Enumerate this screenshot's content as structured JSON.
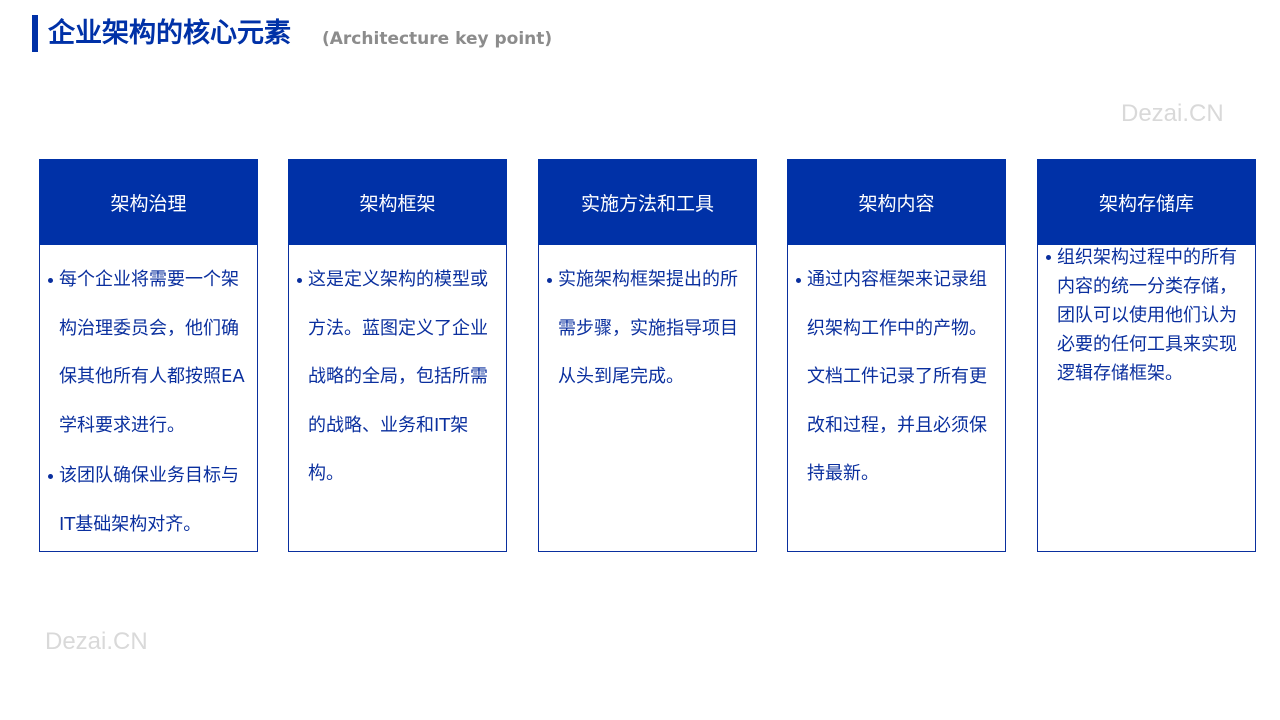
{
  "title": "企业架构的核心元素",
  "subtitle": "(Architecture key point)",
  "watermark": "Dezai.CN",
  "colors": {
    "accent": "#0031a7",
    "card_border": "#0a2f9e",
    "body_text": "#0a2f9e",
    "subtitle": "#8c8c8c",
    "watermark": "#d9d9d9"
  },
  "cards": [
    {
      "header": "架构治理",
      "bullets": [
        "每个企业将需要一个架构治理委员会，他们确保其他所有人都按照EA学科要求进行。",
        "该团队确保业务目标与IT基础架构对齐。"
      ]
    },
    {
      "header": "架构框架",
      "bullets": [
        "这是定义架构的模型或方法。蓝图定义了企业战略的全局，包括所需的战略、业务和IT架构。"
      ]
    },
    {
      "header": "实施方法和工具",
      "bullets": [
        "实施架构框架提出的所需步骤，实施指导项目从头到尾完成。"
      ]
    },
    {
      "header": "架构内容",
      "bullets": [
        "通过内容框架来记录组织架构工作中的产物。文档工件记录了所有更改和过程，并且必须保持最新。"
      ]
    },
    {
      "header": "架构存储库",
      "bullets": [
        "组织架构过程中的所有内容的统一分类存储，团队可以使用他们认为必要的任何工具来实现逻辑存储框架。"
      ]
    }
  ]
}
